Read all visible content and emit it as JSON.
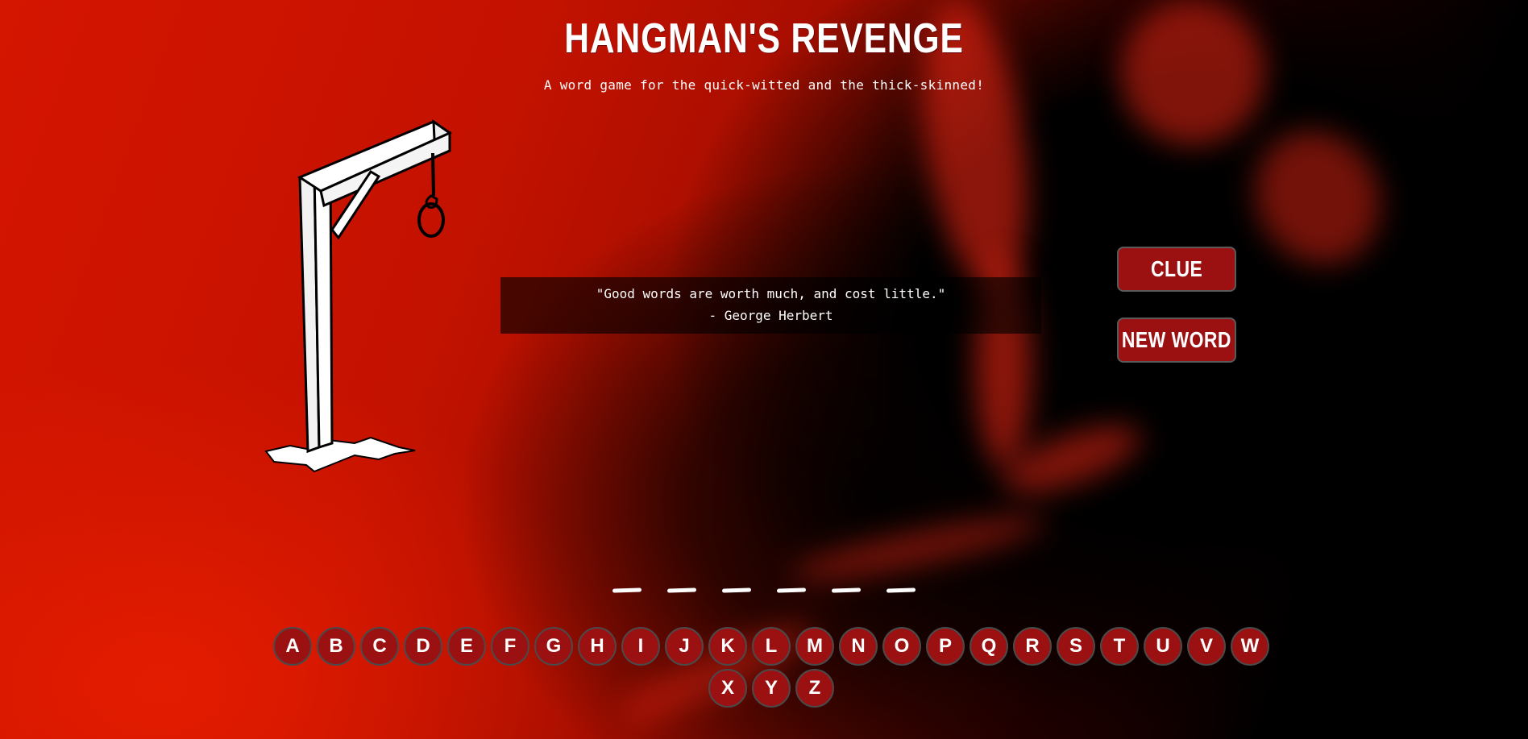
{
  "header": {
    "title": "HANGMAN'S REVENGE",
    "subtitle": "A word game for the quick-witted and the thick-skinned!"
  },
  "quote": {
    "text": "\"Good words are worth much, and cost little.\"",
    "author": "- George Herbert"
  },
  "buttons": {
    "clue_label": "CLUE",
    "new_word_label": "NEW WORD"
  },
  "word": {
    "blank_count": 6
  },
  "keyboard": {
    "row1": [
      "A",
      "B",
      "C",
      "D",
      "E",
      "F",
      "G",
      "H",
      "I",
      "J",
      "K",
      "L",
      "M",
      "N",
      "O",
      "P",
      "Q",
      "R",
      "S",
      "T",
      "U",
      "V",
      "W"
    ],
    "row2": [
      "X",
      "Y",
      "Z"
    ]
  },
  "colors": {
    "button_bg": "#9b1112",
    "background_red": "#c41200",
    "background_dark": "#000000"
  },
  "icons": {
    "gallows": "gallows-with-noose"
  }
}
